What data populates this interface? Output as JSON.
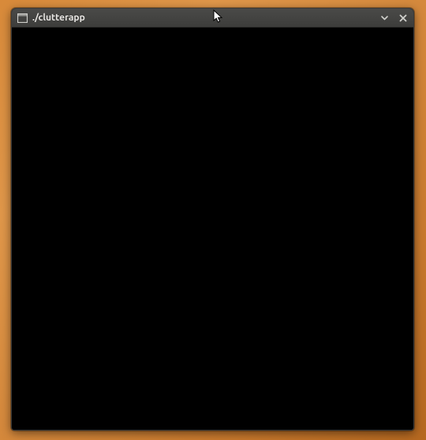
{
  "window": {
    "title": "./clutterapp",
    "icon_name": "app-window-icon"
  },
  "controls": {
    "minimize": {
      "label": "minimize"
    },
    "close": {
      "label": "close"
    }
  }
}
